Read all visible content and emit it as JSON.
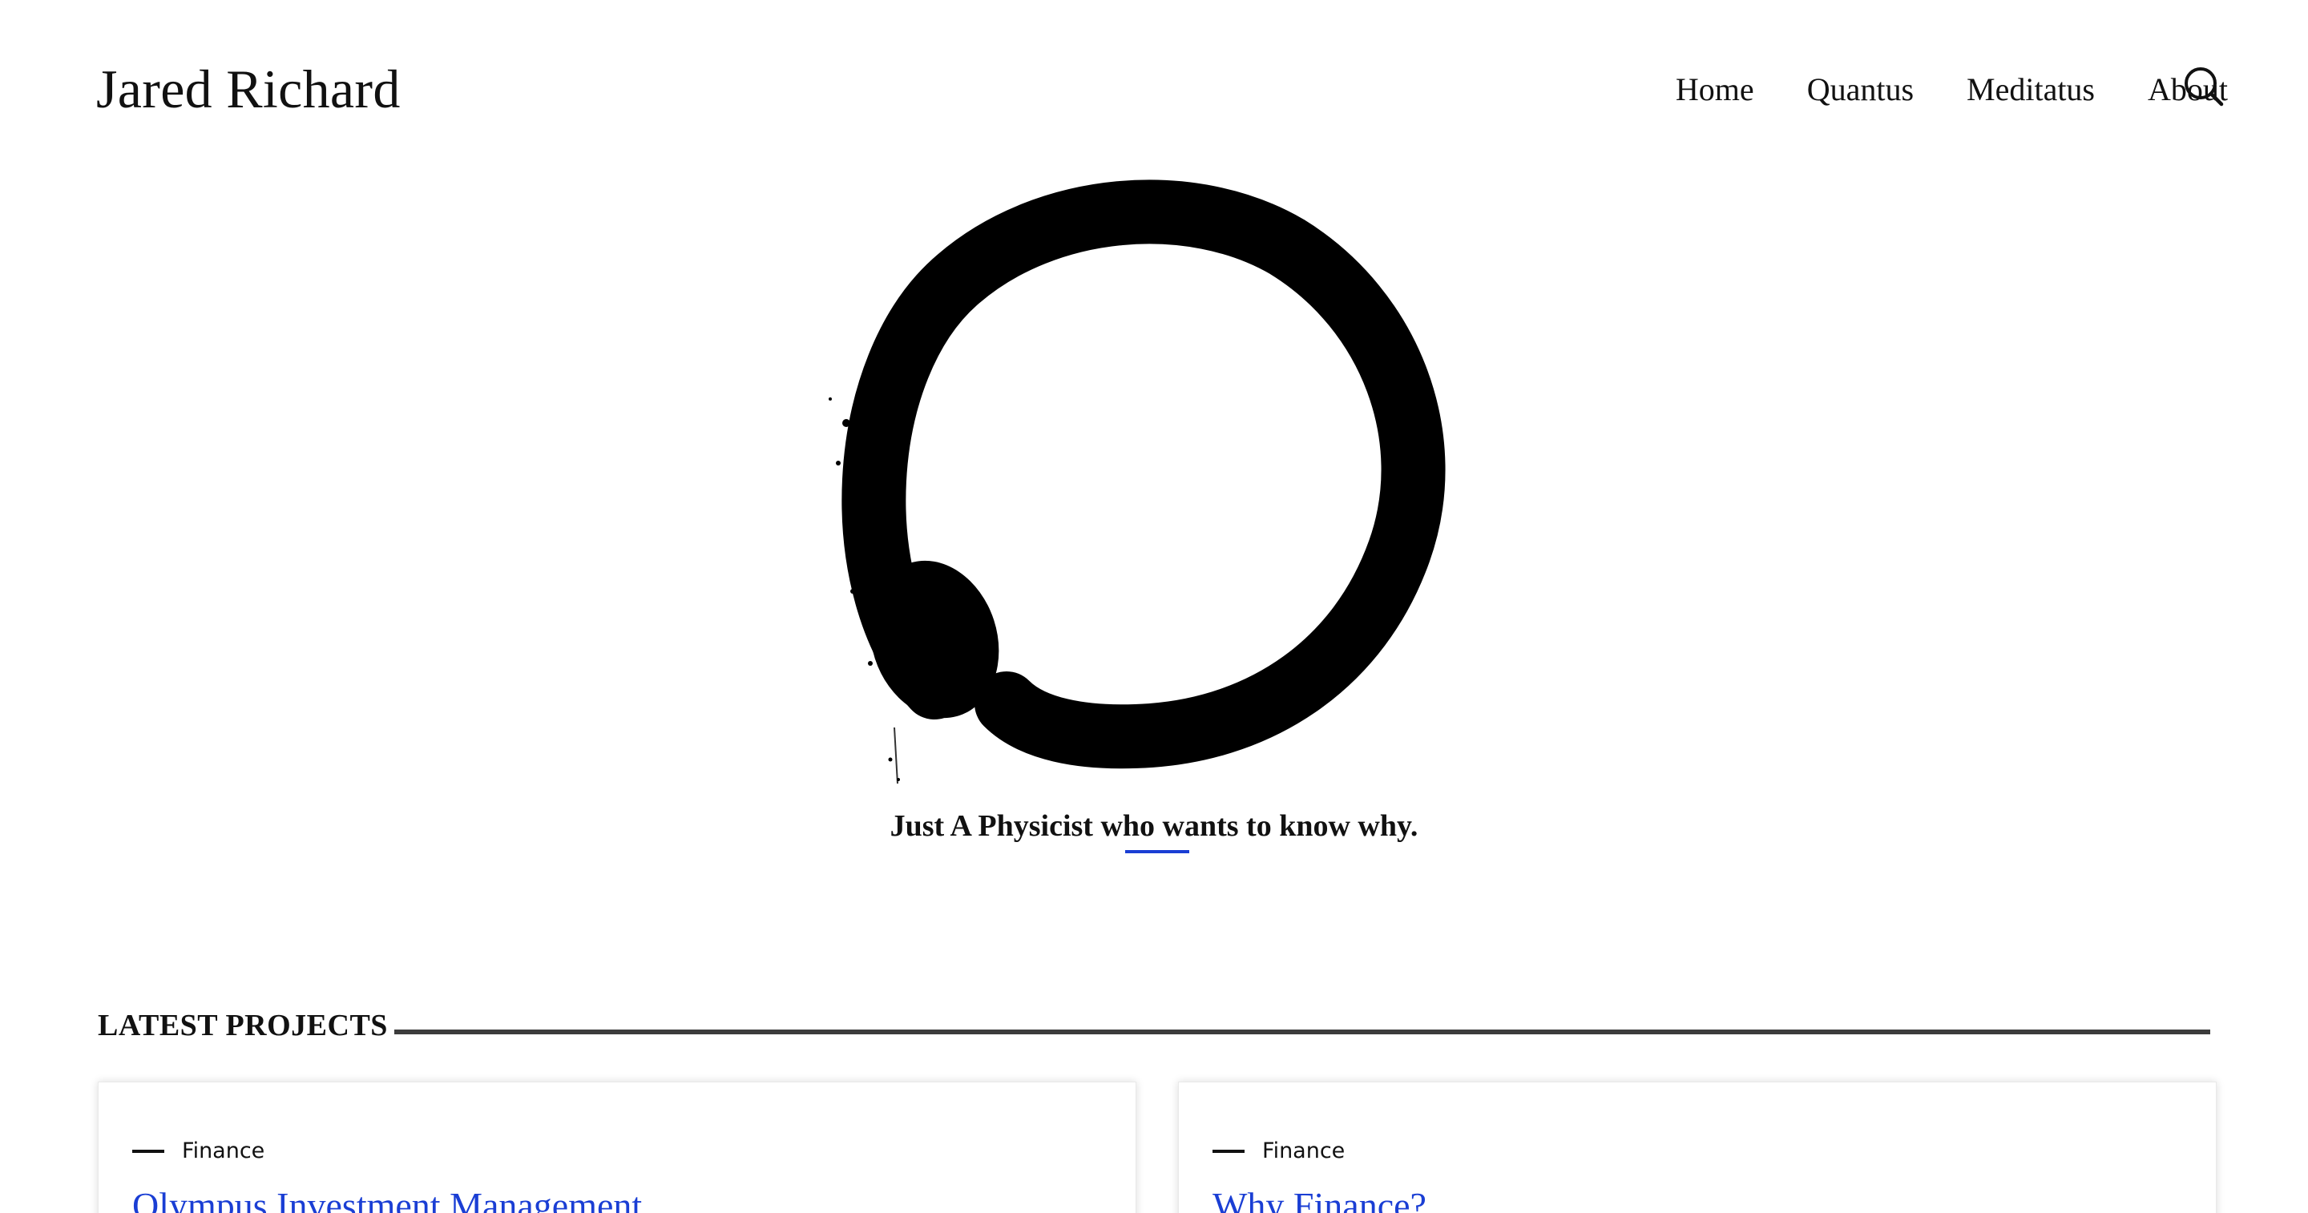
{
  "header": {
    "site_title": "Jared Richard",
    "nav": [
      {
        "label": "Home"
      },
      {
        "label": "Quantus"
      },
      {
        "label": "Meditatus"
      },
      {
        "label": "About"
      }
    ],
    "search_icon": "search-icon"
  },
  "hero": {
    "logo_icon": "enso-circle-logo",
    "tagline": "Just A Physicist who wants to know why."
  },
  "latest_projects": {
    "heading": "LATEST PROJECTS",
    "cards": [
      {
        "category": "Finance",
        "title": "Olympus Investment Management"
      },
      {
        "category": "Finance",
        "title": "Why Finance?"
      }
    ]
  },
  "colors": {
    "accent": "#1a3ed4",
    "text": "#111111",
    "rule": "#3c3c3c",
    "background": "#ffffff"
  }
}
